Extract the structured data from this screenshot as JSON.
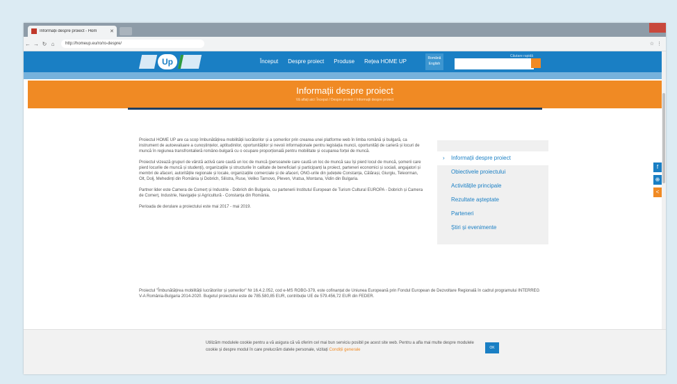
{
  "browser": {
    "tab_title": "Informații despre proiect - Hom",
    "address": "http://homeup.eu/ro/ro-despre/",
    "colors": {
      "titlebar": "#8e9ca8",
      "close": "#c8483c"
    }
  },
  "header": {
    "logo_text": "Up",
    "nav": [
      "Început",
      "Despre proiect",
      "Produse",
      "Rețea HOME UP"
    ],
    "lang": [
      "Română",
      "English"
    ],
    "search_label": "Căutare rapidă",
    "colors": {
      "header": "#1a7fc4",
      "accent": "#f08a24"
    }
  },
  "banner": {
    "title": "Informații despre proiect",
    "breadcrumb": "Vă aflați aici: Început / Despre proiect / Informații despre proiect"
  },
  "content": {
    "paragraphs": [
      "Proiectul HOME UP are ca scop îmbunătățirea mobilității lucrătorilor și a șomerilor prin crearea unei platforme web în limba română și bulgară, ca instrument de autoevaluare a cunoștințelor, aptitudinilor, oportunităților și nevoii informaționale pentru legislația muncii, oportunități de carieră și locuri de muncă în regiunea transfrontalieră româno-bulgară cu o ocupare proporțională pentru mobilitate și ocuparea forței de muncă.",
      "Proiectul vizează grupuri de vârstă activă care caută un loc de muncă (persoanele care caută un loc de muncă sau își pierd locul de muncă, șomerii care pierd locurile de muncă și studenți), organizațiile și structurile în calitate de beneficiari și participanți la proiect, parteneri economici și sociali, angajatori și membri de afaceri, autoritățile regionale și locale, organizațiile comerciale și de afaceri, ONG-urile din județele Constanța, Călărași, Giurgiu, Teleorman, Olt, Dolj, Mehedinți din România și Dobrich, Silistra, Ruse, Veliko Tarnovo, Pleven, Vratsa, Montana, Vidin din Bulgaria.",
      "Partner lider este Camera de Comerț și Industrie - Dobrich din Bulgaria, cu partenerii Institutul European de Turism Cultural EUROPA - Dobrich și Camera de Comerț, Industrie, Navigație și Agricultură - Constanța din România.",
      "Perioada de derulare a proiectului este mai 2017 - mai 2019."
    ],
    "wide_paragraph": "Proiectul \"Îmbunătățirea mobilității lucrătorilor și șomerilor\" Nr 16.4.2.052, cod e-MS ROBG-379, este cofinanțat de Uniunea Europeană prin Fondul European de Dezvoltare Regională în cadrul programului INTERREG V-A România-Bulgaria 2014-2020. Bugetul proiectului este de 785.580,85 EUR, contribuție UE de 579.456,72 EUR din FEDER."
  },
  "sidebar": {
    "items": [
      "Informații despre proiect",
      "Obiectivele proiectului",
      "Activitățile principale",
      "Rezultate așteptate",
      "Parteneri",
      "Știri și evenimente"
    ]
  },
  "floating": {
    "icons": [
      "facebook-icon",
      "link-icon",
      "share-icon"
    ]
  },
  "cookie": {
    "text": "Utilizăm modulele cookie pentru a vă asigura că vă oferim cel mai bun serviciu posibil pe acest site web. Pentru a afla mai multe despre modulele cookie și despre modul în care prelucrăm datele personale, vizitați",
    "link": "Condiții generale",
    "ok": "OK"
  }
}
